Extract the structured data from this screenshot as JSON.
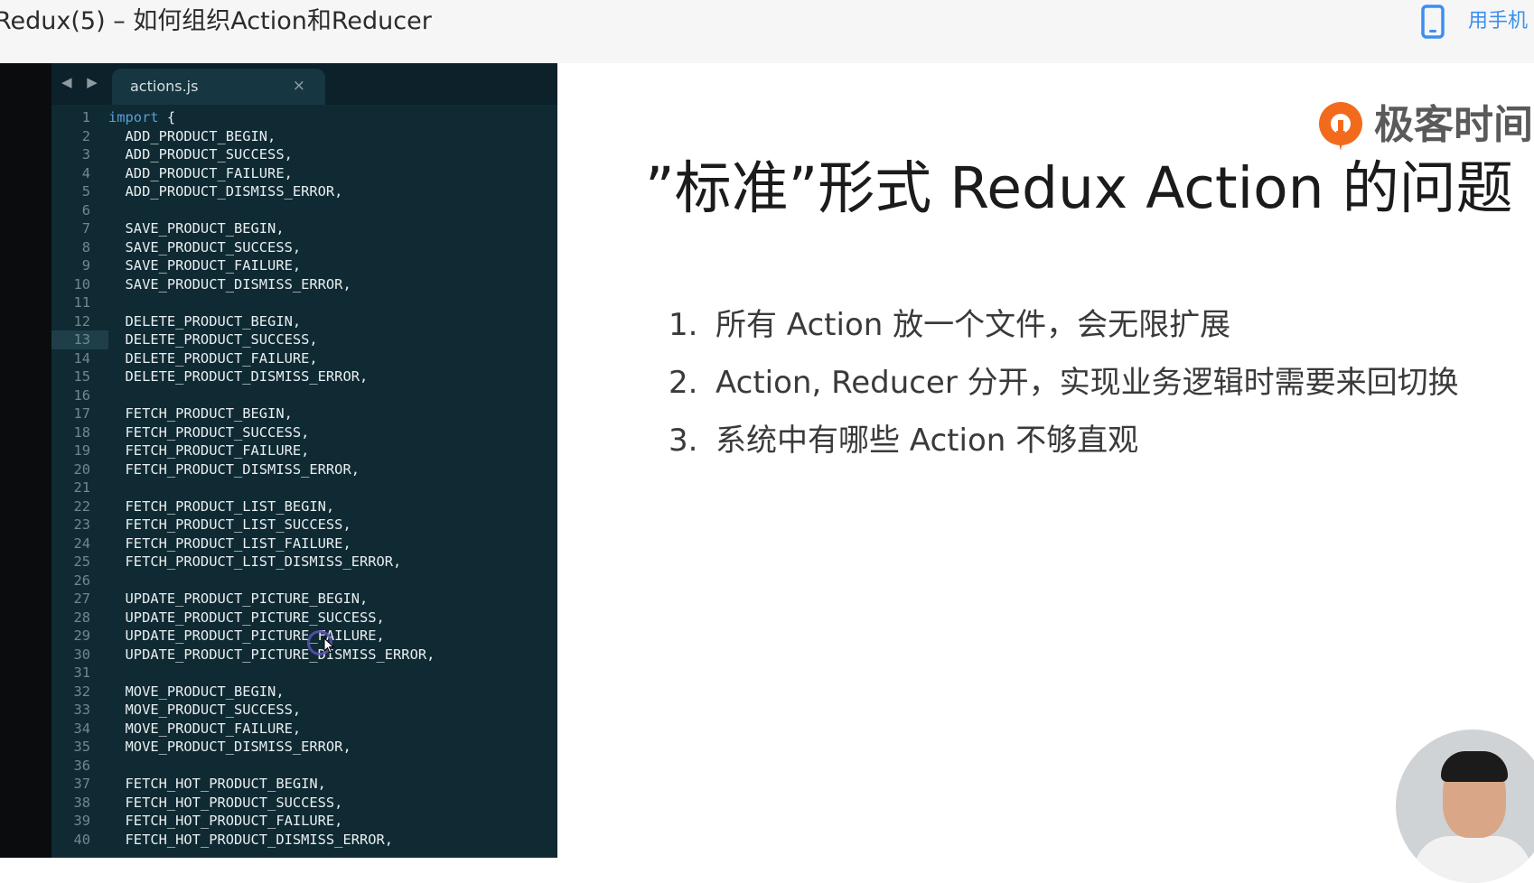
{
  "header": {
    "title": "Redux(5) – 如何组织Action和Reducer",
    "mobile_label": "用手机",
    "mobile_icon": "mobile-phone-icon",
    "accent_color": "#3b8ff0"
  },
  "editor": {
    "nav_arrows": "◀ ▶",
    "tab_name": "actions.js",
    "tab_close": "×",
    "active_line": 13,
    "lines": [
      {
        "n": "1",
        "kw": "import",
        "text": " {"
      },
      {
        "n": "2",
        "kw": "",
        "text": "  ADD_PRODUCT_BEGIN,"
      },
      {
        "n": "3",
        "kw": "",
        "text": "  ADD_PRODUCT_SUCCESS,"
      },
      {
        "n": "4",
        "kw": "",
        "text": "  ADD_PRODUCT_FAILURE,"
      },
      {
        "n": "5",
        "kw": "",
        "text": "  ADD_PRODUCT_DISMISS_ERROR,"
      },
      {
        "n": "6",
        "kw": "",
        "text": ""
      },
      {
        "n": "7",
        "kw": "",
        "text": "  SAVE_PRODUCT_BEGIN,"
      },
      {
        "n": "8",
        "kw": "",
        "text": "  SAVE_PRODUCT_SUCCESS,"
      },
      {
        "n": "9",
        "kw": "",
        "text": "  SAVE_PRODUCT_FAILURE,"
      },
      {
        "n": "10",
        "kw": "",
        "text": "  SAVE_PRODUCT_DISMISS_ERROR,"
      },
      {
        "n": "11",
        "kw": "",
        "text": ""
      },
      {
        "n": "12",
        "kw": "",
        "text": "  DELETE_PRODUCT_BEGIN,"
      },
      {
        "n": "13",
        "kw": "",
        "text": "  DELETE_PRODUCT_SUCCESS,"
      },
      {
        "n": "14",
        "kw": "",
        "text": "  DELETE_PRODUCT_FAILURE,"
      },
      {
        "n": "15",
        "kw": "",
        "text": "  DELETE_PRODUCT_DISMISS_ERROR,"
      },
      {
        "n": "16",
        "kw": "",
        "text": ""
      },
      {
        "n": "17",
        "kw": "",
        "text": "  FETCH_PRODUCT_BEGIN,"
      },
      {
        "n": "18",
        "kw": "",
        "text": "  FETCH_PRODUCT_SUCCESS,"
      },
      {
        "n": "19",
        "kw": "",
        "text": "  FETCH_PRODUCT_FAILURE,"
      },
      {
        "n": "20",
        "kw": "",
        "text": "  FETCH_PRODUCT_DISMISS_ERROR,"
      },
      {
        "n": "21",
        "kw": "",
        "text": ""
      },
      {
        "n": "22",
        "kw": "",
        "text": "  FETCH_PRODUCT_LIST_BEGIN,"
      },
      {
        "n": "23",
        "kw": "",
        "text": "  FETCH_PRODUCT_LIST_SUCCESS,"
      },
      {
        "n": "24",
        "kw": "",
        "text": "  FETCH_PRODUCT_LIST_FAILURE,"
      },
      {
        "n": "25",
        "kw": "",
        "text": "  FETCH_PRODUCT_LIST_DISMISS_ERROR,"
      },
      {
        "n": "26",
        "kw": "",
        "text": ""
      },
      {
        "n": "27",
        "kw": "",
        "text": "  UPDATE_PRODUCT_PICTURE_BEGIN,"
      },
      {
        "n": "28",
        "kw": "",
        "text": "  UPDATE_PRODUCT_PICTURE_SUCCESS,"
      },
      {
        "n": "29",
        "kw": "",
        "text": "  UPDATE_PRODUCT_PICTURE_FAILURE,"
      },
      {
        "n": "30",
        "kw": "",
        "text": "  UPDATE_PRODUCT_PICTURE_DISMISS_ERROR,"
      },
      {
        "n": "31",
        "kw": "",
        "text": ""
      },
      {
        "n": "32",
        "kw": "",
        "text": "  MOVE_PRODUCT_BEGIN,"
      },
      {
        "n": "33",
        "kw": "",
        "text": "  MOVE_PRODUCT_SUCCESS,"
      },
      {
        "n": "34",
        "kw": "",
        "text": "  MOVE_PRODUCT_FAILURE,"
      },
      {
        "n": "35",
        "kw": "",
        "text": "  MOVE_PRODUCT_DISMISS_ERROR,"
      },
      {
        "n": "36",
        "kw": "",
        "text": ""
      },
      {
        "n": "37",
        "kw": "",
        "text": "  FETCH_HOT_PRODUCT_BEGIN,"
      },
      {
        "n": "38",
        "kw": "",
        "text": "  FETCH_HOT_PRODUCT_SUCCESS,"
      },
      {
        "n": "39",
        "kw": "",
        "text": "  FETCH_HOT_PRODUCT_FAILURE,"
      },
      {
        "n": "40",
        "kw": "",
        "text": "  FETCH_HOT_PRODUCT_DISMISS_ERROR,"
      }
    ]
  },
  "slide": {
    "logo_text": "极客时间",
    "logo_icon": "geektime-logo-icon",
    "logo_color": "#f26b1d",
    "heading": "”标准”形式 Redux Action 的问题",
    "items": [
      {
        "num": "1.",
        "text": "所有 Action 放一个文件，会无限扩展"
      },
      {
        "num": "2.",
        "text": "Action, Reducer 分开，实现业务逻辑时需要来回切换"
      },
      {
        "num": "3.",
        "text": "系统中有哪些 Action 不够直观"
      }
    ]
  },
  "presenter": {
    "icon": "presenter-video-avatar"
  }
}
